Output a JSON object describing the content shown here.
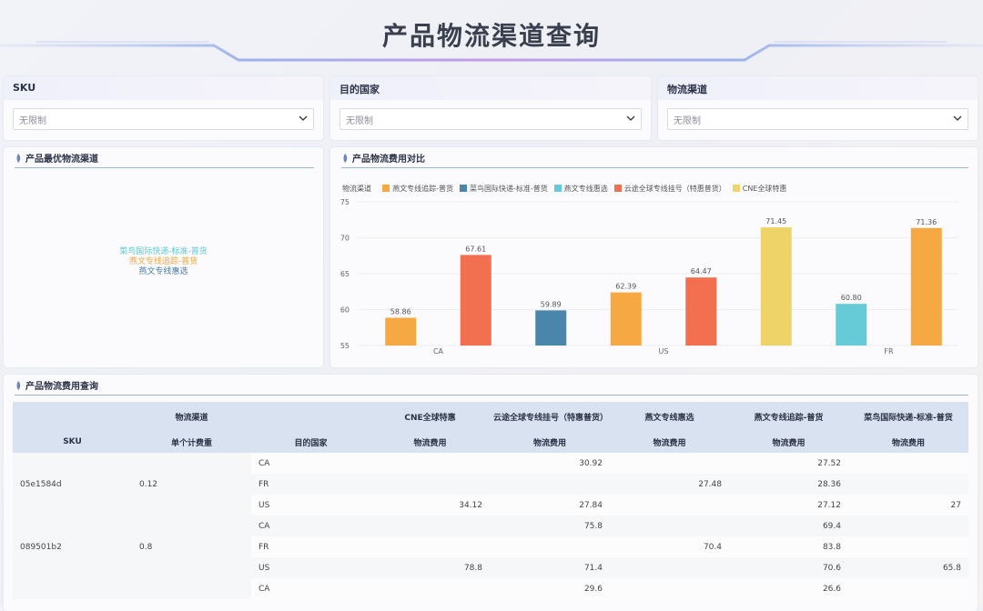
{
  "header": {
    "title": "产品物流渠道查询"
  },
  "filters": [
    {
      "label": "SKU",
      "value": "无限制"
    },
    {
      "label": "目的国家",
      "value": "无限制"
    },
    {
      "label": "物流渠道",
      "value": "无限制"
    }
  ],
  "best_channel": {
    "title": "产品最优物流渠道",
    "items": [
      {
        "text": "菜鸟国际快递-标准-普货",
        "color": "#5fc8d4"
      },
      {
        "text": "燕文专线追踪-普货",
        "color": "#f4a73a"
      },
      {
        "text": "燕文专线惠选",
        "color": "#4a7fa8"
      }
    ]
  },
  "cost_chart": {
    "title": "产品物流费用对比",
    "legend_title": "物流渠道"
  },
  "chart_data": {
    "type": "bar",
    "categories": [
      "CA",
      "US",
      "FR"
    ],
    "ylim": [
      55,
      75
    ],
    "yticks": [
      55,
      60,
      65,
      70,
      75
    ],
    "series": [
      {
        "name": "燕文专线追踪-普货",
        "color": "#f6a843"
      },
      {
        "name": "菜鸟国际快递-标准-普货",
        "color": "#4a86ab"
      },
      {
        "name": "燕文专线惠选",
        "color": "#66cbd6"
      },
      {
        "name": "云途全球专线挂号（特惠普货）",
        "color": "#f2704f"
      },
      {
        "name": "CNE全球特惠",
        "color": "#eed468"
      }
    ],
    "bars": [
      {
        "category": "CA",
        "series": "燕文专线追踪-普货",
        "value": 58.86,
        "label": "58.86"
      },
      {
        "category": "CA",
        "series": "云途全球专线挂号（特惠普货）",
        "value": 67.61,
        "label": "67.61"
      },
      {
        "category": "US",
        "series": "菜鸟国际快递-标准-普货",
        "value": 59.89,
        "label": "59.89"
      },
      {
        "category": "US",
        "series": "燕文专线追踪-普货",
        "value": 62.39,
        "label": "62.39"
      },
      {
        "category": "US",
        "series": "云途全球专线挂号（特惠普货）",
        "value": 64.47,
        "label": "64.47"
      },
      {
        "category": "US",
        "series": "CNE全球特惠",
        "value": 71.45,
        "label": "71.45"
      },
      {
        "category": "FR",
        "series": "燕文专线惠选",
        "value": 60.8,
        "label": "60.80"
      },
      {
        "category": "FR",
        "series": "燕文专线追踪-普货",
        "value": 71.36,
        "label": "71.36"
      }
    ]
  },
  "table": {
    "title": "产品物流费用查询",
    "group_header": "物流渠道",
    "row_headers": [
      "SKU",
      "单个计费重",
      "目的国家"
    ],
    "channels": [
      "CNE全球特惠",
      "云途全球专线挂号（特惠普货）",
      "燕文专线惠选",
      "燕文专线追踪-普货",
      "菜鸟国际快递-标准-普货"
    ],
    "metric": "物流费用",
    "groups": [
      {
        "sku": "05e1584d",
        "weight": "0.12",
        "rows": [
          {
            "country": "CA",
            "vals": [
              "",
              "30.92",
              "",
              "27.52",
              ""
            ]
          },
          {
            "country": "FR",
            "vals": [
              "",
              "",
              "27.48",
              "28.36",
              ""
            ]
          },
          {
            "country": "US",
            "vals": [
              "34.12",
              "27.84",
              "",
              "27.12",
              "27"
            ]
          }
        ]
      },
      {
        "sku": "089501b2",
        "weight": "0.8",
        "rows": [
          {
            "country": "CA",
            "vals": [
              "",
              "75.8",
              "",
              "69.4",
              ""
            ]
          },
          {
            "country": "FR",
            "vals": [
              "",
              "",
              "70.4",
              "83.8",
              ""
            ]
          },
          {
            "country": "US",
            "vals": [
              "78.8",
              "71.4",
              "",
              "70.6",
              "65.8"
            ]
          }
        ]
      },
      {
        "sku": "",
        "weight": "",
        "rows": [
          {
            "country": "CA",
            "vals": [
              "",
              "29.6",
              "",
              "26.6",
              ""
            ]
          }
        ]
      }
    ]
  }
}
